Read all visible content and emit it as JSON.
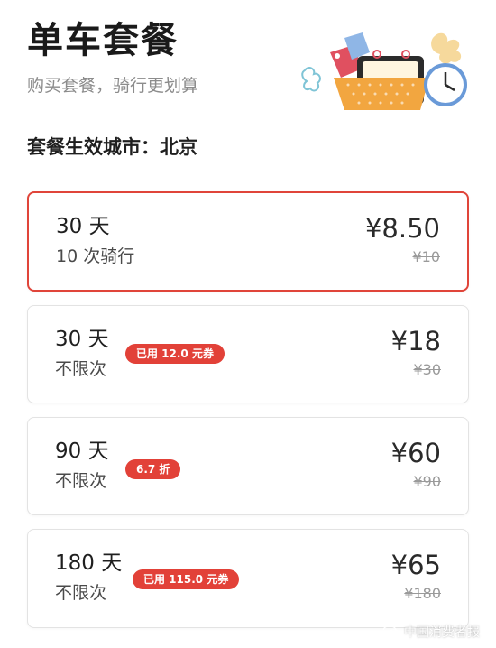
{
  "header": {
    "title": "单车套餐",
    "subtitle": "购买套餐，骑行更划算",
    "city_line": "套餐生效城市：北京"
  },
  "plans": [
    {
      "duration": "30 天",
      "rides": "10 次骑行",
      "price": "¥8.50",
      "original_price": "¥10",
      "badge": "",
      "selected": true
    },
    {
      "duration": "30 天",
      "rides": "不限次",
      "price": "¥18",
      "original_price": "¥30",
      "badge": "已用 12.0 元券",
      "selected": false
    },
    {
      "duration": "90 天",
      "rides": "不限次",
      "price": "¥60",
      "original_price": "¥90",
      "badge": "6.7 折",
      "selected": false
    },
    {
      "duration": "180 天",
      "rides": "不限次",
      "price": "¥65",
      "original_price": "¥180",
      "badge": "已用 115.0 元券",
      "selected": false
    }
  ],
  "watermark": {
    "text": "中国消费者报",
    "icon": "wechat-icon"
  },
  "colors": {
    "accent": "#e24138",
    "selected_border": "#e0453a",
    "card_border": "#e3e3e3"
  }
}
